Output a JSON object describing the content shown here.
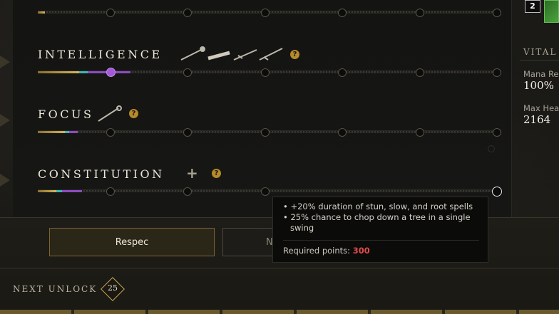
{
  "attributes": [
    {
      "name": "INTELLIGENCE",
      "has_plus": false
    },
    {
      "name": "FOCUS",
      "has_plus": false
    },
    {
      "name": "CONSTITUTION",
      "has_plus": true
    }
  ],
  "help_icon": "?",
  "buttons": {
    "respec": "Respec",
    "second_partial": "N"
  },
  "tooltip": {
    "bullets": [
      "+20% duration of stun, slow, and root spells",
      "25% chance to chop down a tree in a single swing"
    ],
    "required_label": "Required points:",
    "required_value": "300"
  },
  "next_unlock": {
    "label": "NEXT UNLOCK",
    "level": "25"
  },
  "side": {
    "badge": "2",
    "vitals_title": "VITAL",
    "stats": [
      {
        "label": "Mana Re",
        "value": "100%"
      },
      {
        "label": "Max Hea",
        "value": "2164"
      }
    ]
  },
  "colors": {
    "accent_gold": "#d8b55a",
    "mana_purple": "#8d4bc2",
    "teal": "#3bb7b0",
    "required_red": "#e24a4a"
  }
}
